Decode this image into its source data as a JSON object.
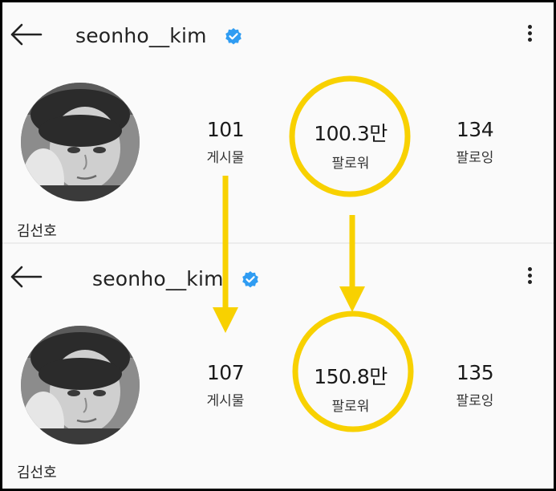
{
  "profiles": [
    {
      "username": "seonho__kim",
      "name": "김선호",
      "stats": {
        "posts": {
          "value": "101",
          "label": "게시물"
        },
        "followers": {
          "value": "100.3만",
          "label": "팔로워"
        },
        "following": {
          "value": "134",
          "label": "팔로잉"
        }
      }
    },
    {
      "username": "seonho__kim",
      "name": "김선호",
      "stats": {
        "posts": {
          "value": "107",
          "label": "게시물"
        },
        "followers": {
          "value": "150.8만",
          "label": "팔로워"
        },
        "following": {
          "value": "135",
          "label": "팔로잉"
        }
      }
    }
  ],
  "icons": {
    "back": "back-arrow-icon",
    "verified": "verified-badge-icon",
    "more": "more-vertical-icon"
  },
  "colors": {
    "highlight": "#f8d100",
    "verified": "#2f9cf2"
  }
}
